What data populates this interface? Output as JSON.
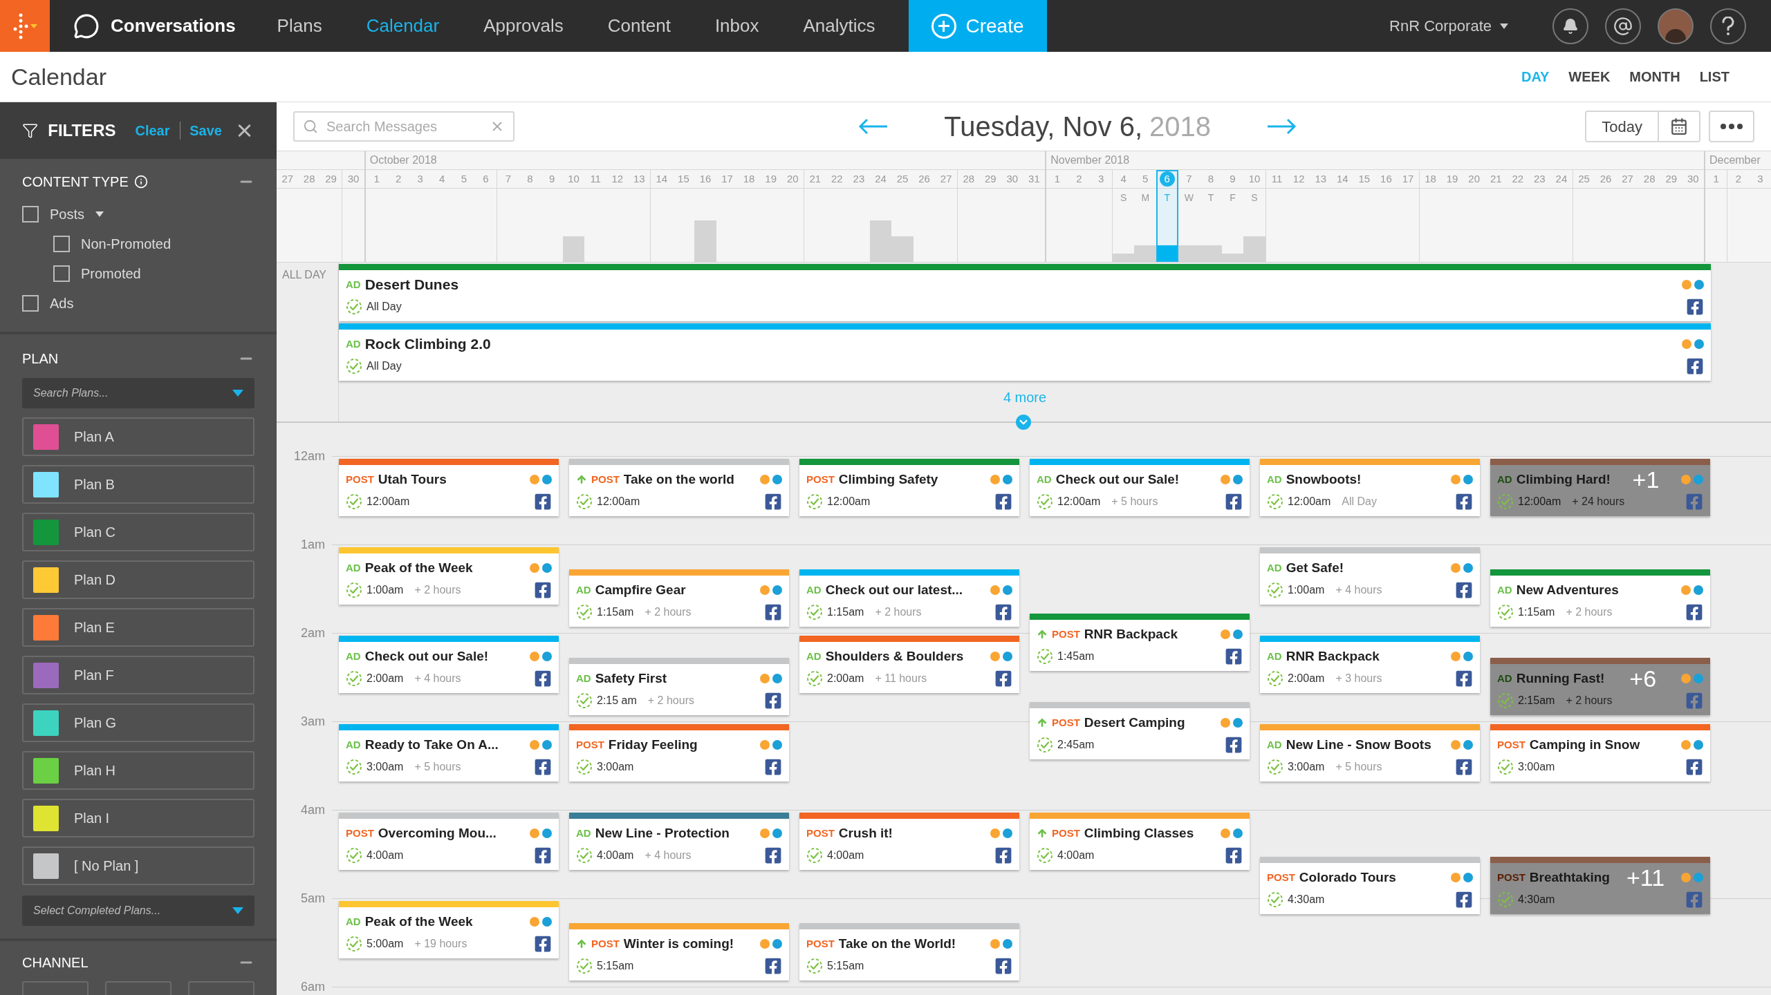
{
  "nav": {
    "brand": "Conversations",
    "items": [
      {
        "label": "Plans",
        "selected": false
      },
      {
        "label": "Calendar",
        "selected": true
      },
      {
        "label": "Approvals",
        "selected": false
      },
      {
        "label": "Content",
        "selected": false
      },
      {
        "label": "Inbox",
        "selected": false
      },
      {
        "label": "Analytics",
        "selected": false
      }
    ],
    "create": "Create",
    "account": "RnR Corporate"
  },
  "page": {
    "title": "Calendar",
    "views": [
      {
        "label": "DAY",
        "selected": true
      },
      {
        "label": "WEEK",
        "selected": false
      },
      {
        "label": "MONTH",
        "selected": false
      },
      {
        "label": "LIST",
        "selected": false
      }
    ]
  },
  "filters": {
    "title": "FILTERS",
    "clear": "Clear",
    "save": "Save",
    "content_type": {
      "title": "CONTENT TYPE",
      "options": [
        {
          "label": "Posts",
          "checked": false,
          "children": [
            {
              "label": "Non-Promoted",
              "checked": false
            },
            {
              "label": "Promoted",
              "checked": false
            }
          ]
        },
        {
          "label": "Ads",
          "checked": false
        }
      ]
    },
    "plan": {
      "title": "PLAN",
      "search": {
        "placeholder": "Search Plans..."
      },
      "plans": [
        {
          "label": "Plan A",
          "color": "#e04f94"
        },
        {
          "label": "Plan B",
          "color": "#80e4ff"
        },
        {
          "label": "Plan C",
          "color": "#13963c"
        },
        {
          "label": "Plan D",
          "color": "#fdc935"
        },
        {
          "label": "Plan E",
          "color": "#fd7a38"
        },
        {
          "label": "Plan F",
          "color": "#9b6abd"
        },
        {
          "label": "Plan G",
          "color": "#3dd4bf"
        },
        {
          "label": "Plan H",
          "color": "#6bd043"
        },
        {
          "label": "Plan I",
          "color": "#dfe331"
        },
        {
          "label": "[ No Plan ]",
          "color": "#c4c6c7"
        }
      ],
      "completed": {
        "placeholder": "Select Completed Plans..."
      }
    },
    "channel": {
      "title": "CHANNEL"
    }
  },
  "toolbar": {
    "search": {
      "placeholder": "Search Messages"
    },
    "date": "Tuesday, Nov 6,",
    "year": "2018",
    "today": "Today"
  },
  "timeline": {
    "months": [
      {
        "days": [
          {
            "label": "27",
            "selected": false
          },
          {
            "label": "28",
            "selected": false
          },
          {
            "label": "29",
            "selected": false
          },
          {
            "label": "30",
            "selected": false
          }
        ]
      },
      {
        "label": "October 2018",
        "days": [
          {
            "label": "1",
            "selected": false
          },
          {
            "label": "2",
            "selected": false
          },
          {
            "label": "3",
            "selected": false
          },
          {
            "label": "4",
            "selected": false
          },
          {
            "label": "5",
            "selected": false
          },
          {
            "label": "6",
            "selected": false
          },
          {
            "label": "7",
            "selected": false
          },
          {
            "label": "8",
            "selected": false
          },
          {
            "label": "9",
            "selected": false
          },
          {
            "label": "10",
            "selected": false
          },
          {
            "label": "11",
            "selected": false
          },
          {
            "label": "12",
            "selected": false
          },
          {
            "label": "13",
            "selected": false
          },
          {
            "label": "14",
            "selected": false
          },
          {
            "label": "15",
            "selected": false
          },
          {
            "label": "16",
            "selected": false
          },
          {
            "label": "17",
            "selected": false
          },
          {
            "label": "18",
            "selected": false
          },
          {
            "label": "19",
            "selected": false
          },
          {
            "label": "20",
            "selected": false
          },
          {
            "label": "21",
            "selected": false
          },
          {
            "label": "22",
            "selected": false
          },
          {
            "label": "23",
            "selected": false
          },
          {
            "label": "24",
            "selected": false
          },
          {
            "label": "25",
            "selected": false
          },
          {
            "label": "26",
            "selected": false
          },
          {
            "label": "27",
            "selected": false
          },
          {
            "label": "28",
            "selected": false
          },
          {
            "label": "29",
            "selected": false
          },
          {
            "label": "30",
            "selected": false
          },
          {
            "label": "31",
            "selected": false
          }
        ]
      },
      {
        "label": "November 2018",
        "days": [
          {
            "label": "1",
            "selected": false
          },
          {
            "label": "2",
            "selected": false
          },
          {
            "label": "3",
            "selected": false
          },
          {
            "label": "4",
            "selected": false,
            "weekday": "S"
          },
          {
            "label": "5",
            "selected": false,
            "weekday": "M"
          },
          {
            "label": "6",
            "selected": true,
            "weekday": "T"
          },
          {
            "label": "7",
            "selected": false,
            "weekday": "W"
          },
          {
            "label": "8",
            "selected": false,
            "weekday": "T"
          },
          {
            "label": "9",
            "selected": false,
            "weekday": "F"
          },
          {
            "label": "10",
            "selected": false,
            "weekday": "S"
          },
          {
            "label": "11",
            "selected": false
          },
          {
            "label": "12",
            "selected": false
          },
          {
            "label": "13",
            "selected": false
          },
          {
            "label": "14",
            "selected": false
          },
          {
            "label": "15",
            "selected": false
          },
          {
            "label": "16",
            "selected": false
          },
          {
            "label": "17",
            "selected": false
          },
          {
            "label": "18",
            "selected": false
          },
          {
            "label": "19",
            "selected": false
          },
          {
            "label": "20",
            "selected": false
          },
          {
            "label": "21",
            "selected": false
          },
          {
            "label": "22",
            "selected": false
          },
          {
            "label": "23",
            "selected": false
          },
          {
            "label": "24",
            "selected": false
          },
          {
            "label": "25",
            "selected": false
          },
          {
            "label": "26",
            "selected": false
          },
          {
            "label": "27",
            "selected": false
          },
          {
            "label": "28",
            "selected": false
          },
          {
            "label": "29",
            "selected": false
          },
          {
            "label": "30",
            "selected": false
          }
        ]
      },
      {
        "label": "December",
        "days": [
          {
            "label": "1",
            "selected": false
          },
          {
            "label": "2",
            "selected": false
          },
          {
            "label": "3",
            "selected": false
          }
        ]
      }
    ]
  },
  "all_day": {
    "label": "ALL DAY",
    "events": [
      {
        "kind": "ad",
        "type": "AD",
        "title": "Desert Dunes",
        "time": "All Day",
        "color": "#13963c"
      },
      {
        "kind": "ad",
        "type": "AD",
        "title": "Rock Climbing 2.0",
        "time": "All Day",
        "color": "#00b5ef"
      }
    ],
    "more": "4 more"
  },
  "schedule": {
    "hours": [
      "12am",
      "1am",
      "2am",
      "3am",
      "4am",
      "5am",
      "6am"
    ],
    "columns": [
      {
        "events": [
          {
            "kind": "post",
            "type": "POST",
            "boosted": false,
            "title": "Utah Tours",
            "time": "12:00am",
            "color": "#f26522"
          },
          {
            "kind": "ad",
            "type": "AD",
            "boosted": false,
            "title": "Peak of the Week",
            "time": "1:00am",
            "duration": "+ 2 hours",
            "color": "#fdc52f"
          },
          {
            "kind": "ad",
            "type": "AD",
            "boosted": false,
            "title": "Check out our Sale!",
            "time": "2:00am",
            "duration": "+ 4 hours",
            "color": "#00b5ef"
          },
          {
            "kind": "ad",
            "type": "AD",
            "boosted": false,
            "title": "Ready to Take On A...",
            "time": "3:00am",
            "duration": "+ 5 hours",
            "color": "#00b5ef"
          },
          {
            "kind": "post",
            "type": "POST",
            "boosted": false,
            "title": "Overcoming Mou...",
            "time": "4:00am",
            "color": "#c4c6c7"
          },
          {
            "kind": "ad",
            "type": "AD",
            "boosted": false,
            "title": "Peak of the Week",
            "time": "5:00am",
            "duration": "+ 19 hours",
            "color": "#fdc52f"
          }
        ]
      },
      {
        "events": [
          {
            "kind": "post",
            "type": "POST",
            "boosted": true,
            "title": "Take on the world",
            "time": "12:00am",
            "color": "#c4c6c7"
          },
          {
            "kind": "ad",
            "type": "AD",
            "boosted": false,
            "title": "Campfire Gear",
            "time": "1:15am",
            "duration": "+ 2 hours",
            "color": "#f9a533"
          },
          {
            "kind": "ad",
            "type": "AD",
            "boosted": false,
            "title": "Safety First",
            "time": "2:15 am",
            "duration": "+ 2 hours",
            "color": "#c4c6c7"
          },
          {
            "kind": "post",
            "type": "POST",
            "boosted": false,
            "title": "Friday Feeling",
            "time": "3:00am",
            "color": "#f26522"
          },
          {
            "kind": "ad",
            "type": "AD",
            "boosted": false,
            "title": "New Line - Protection",
            "time": "4:00am",
            "duration": "+ 4 hours",
            "color": "#3a7d96"
          },
          {
            "kind": "post",
            "type": "POST",
            "boosted": true,
            "title": "Winter is coming!",
            "time": "5:15am",
            "color": "#f9a533"
          }
        ]
      },
      {
        "events": [
          {
            "kind": "post",
            "type": "POST",
            "boosted": false,
            "title": "Climbing Safety",
            "time": "12:00am",
            "color": "#13963c"
          },
          {
            "kind": "ad",
            "type": "AD",
            "boosted": false,
            "title": "Check out our latest...",
            "time": "1:15am",
            "duration": "+ 2 hours",
            "color": "#00b5ef"
          },
          {
            "kind": "ad",
            "type": "AD",
            "boosted": false,
            "title": "Shoulders & Boulders",
            "time": "2:00am",
            "duration": "+ 11 hours",
            "color": "#f26522"
          },
          {
            "kind": "post",
            "type": "POST",
            "boosted": false,
            "title": "Crush it!",
            "time": "4:00am",
            "color": "#f26522"
          },
          {
            "kind": "post",
            "type": "POST",
            "boosted": false,
            "title": "Take on the World!",
            "time": "5:15am",
            "color": "#c4c6c7"
          }
        ]
      },
      {
        "events": [
          {
            "kind": "ad",
            "type": "AD",
            "boosted": false,
            "title": "Check out our Sale!",
            "time": "12:00am",
            "duration": "+ 5 hours",
            "color": "#00b5ef"
          },
          {
            "kind": "post",
            "type": "POST",
            "boosted": true,
            "title": "RNR Backpack",
            "time": "1:45am",
            "color": "#13963c"
          },
          {
            "kind": "post",
            "type": "POST",
            "boosted": true,
            "title": "Desert Camping",
            "time": "2:45am",
            "color": "#c4c6c7"
          },
          {
            "kind": "post",
            "type": "POST",
            "boosted": true,
            "title": "Climbing Classes",
            "time": "4:00am",
            "color": "#f9a533"
          }
        ]
      },
      {
        "events": [
          {
            "kind": "ad",
            "type": "AD",
            "boosted": false,
            "title": "Snowboots!",
            "time": "12:00am",
            "duration": "All Day",
            "color": "#f9a533"
          },
          {
            "kind": "ad",
            "type": "AD",
            "boosted": false,
            "title": "Get Safe!",
            "time": "1:00am",
            "duration": "+ 4 hours",
            "color": "#c4c6c7"
          },
          {
            "kind": "ad",
            "type": "AD",
            "boosted": false,
            "title": "RNR Backpack",
            "time": "2:00am",
            "duration": "+ 3 hours",
            "color": "#00b5ef"
          },
          {
            "kind": "ad",
            "type": "AD",
            "boosted": false,
            "title": "New Line - Snow Boots",
            "time": "3:00am",
            "duration": "+ 5 hours",
            "color": "#f9a533"
          },
          {
            "kind": "post",
            "type": "POST",
            "boosted": false,
            "title": "Colorado Tours",
            "time": "4:30am",
            "color": "#c4c6c7"
          }
        ]
      },
      {
        "events": [
          {
            "kind": "ad",
            "type": "AD",
            "boosted": false,
            "title": "Climbing Hard!",
            "time": "12:00am",
            "duration": "+ 24 hours",
            "color": "#8b5e4a",
            "overlay": "+1"
          },
          {
            "kind": "ad",
            "type": "AD",
            "boosted": false,
            "title": "New Adventures",
            "time": "1:15am",
            "duration": "+ 2 hours",
            "color": "#13963c"
          },
          {
            "kind": "ad",
            "type": "AD",
            "boosted": false,
            "title": "Running Fast!",
            "time": "2:15am",
            "duration": "+ 2 hours",
            "color": "#8b5e4a",
            "overlay": "+6"
          },
          {
            "kind": "post",
            "type": "POST",
            "boosted": false,
            "title": "Camping in Snow",
            "time": "3:00am",
            "color": "#f26522"
          },
          {
            "kind": "post",
            "type": "POST",
            "boosted": false,
            "title": "Breathtaking",
            "time": "4:30am",
            "color": "#8b5e4a",
            "overlay": "+11"
          }
        ]
      }
    ]
  }
}
